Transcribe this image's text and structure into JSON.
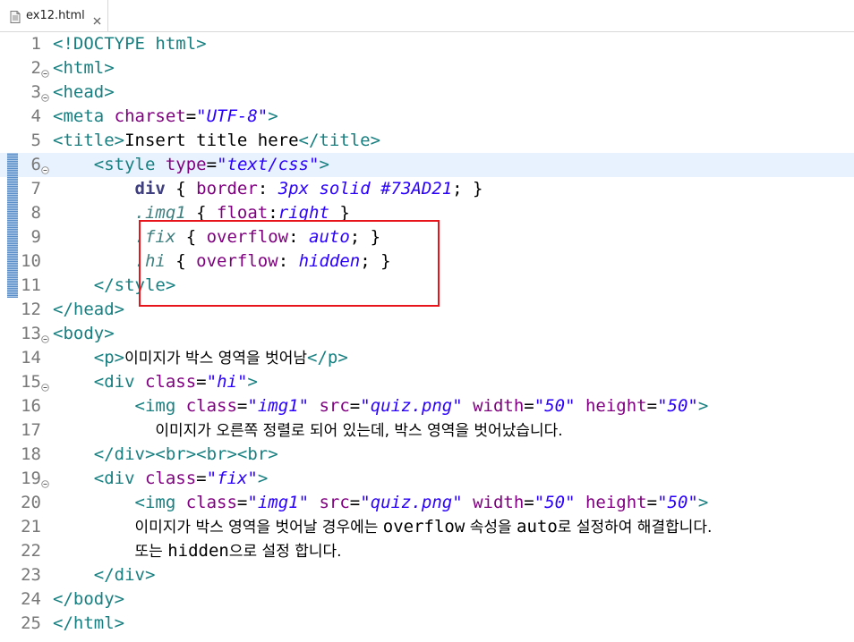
{
  "tab": {
    "filename": "ex12.html",
    "icon": "html-file-icon",
    "close_icon": "close-icon"
  },
  "lines": [
    {
      "num": "1",
      "fold": false,
      "tokens": [
        [
          "tag",
          "<!DOCTYPE html>"
        ]
      ]
    },
    {
      "num": "2",
      "fold": true,
      "tokens": [
        [
          "tag",
          "<html>"
        ]
      ]
    },
    {
      "num": "3",
      "fold": true,
      "tokens": [
        [
          "tag",
          "<head>"
        ]
      ]
    },
    {
      "num": "4",
      "fold": false,
      "tokens": [
        [
          "tag",
          "<meta "
        ],
        [
          "attr",
          "charset"
        ],
        [
          "pun",
          "="
        ],
        [
          "str",
          "\"UTF-8\""
        ],
        [
          "tag",
          ">"
        ]
      ]
    },
    {
      "num": "5",
      "fold": false,
      "tokens": [
        [
          "tag",
          "<title>"
        ],
        [
          "pun",
          "Insert title here"
        ],
        [
          "tag",
          "</title>"
        ]
      ]
    },
    {
      "num": "6",
      "fold": true,
      "tokens": [
        [
          "pun",
          "    "
        ],
        [
          "tag",
          "<style "
        ],
        [
          "attr",
          "type"
        ],
        [
          "pun",
          "="
        ],
        [
          "str",
          "\"text/css\""
        ],
        [
          "tag",
          ">"
        ]
      ]
    },
    {
      "num": "7",
      "fold": false,
      "tokens": [
        [
          "pun",
          "        "
        ],
        [
          "bold",
          "div"
        ],
        [
          "pun",
          " { "
        ],
        [
          "prop",
          "border"
        ],
        [
          "pun",
          ": "
        ],
        [
          "val",
          "3px solid #73AD21"
        ],
        [
          "pun",
          "; }"
        ]
      ]
    },
    {
      "num": "8",
      "fold": false,
      "tokens": [
        [
          "pun",
          "        "
        ],
        [
          "sel",
          ".img1"
        ],
        [
          "pun",
          " { "
        ],
        [
          "prop",
          "float"
        ],
        [
          "pun",
          ":"
        ],
        [
          "val",
          "right"
        ],
        [
          "pun",
          " }"
        ]
      ]
    },
    {
      "num": "9",
      "fold": false,
      "tokens": [
        [
          "pun",
          "        "
        ],
        [
          "sel",
          ".fix"
        ],
        [
          "pun",
          " { "
        ],
        [
          "prop",
          "overflow"
        ],
        [
          "pun",
          ": "
        ],
        [
          "val",
          "auto"
        ],
        [
          "pun",
          "; }"
        ]
      ]
    },
    {
      "num": "10",
      "fold": false,
      "tokens": [
        [
          "pun",
          "        "
        ],
        [
          "sel",
          ".hi"
        ],
        [
          "pun",
          " { "
        ],
        [
          "prop",
          "overflow"
        ],
        [
          "pun",
          ": "
        ],
        [
          "val",
          "hidden"
        ],
        [
          "pun",
          "; }"
        ]
      ]
    },
    {
      "num": "11",
      "fold": false,
      "tokens": [
        [
          "pun",
          "    "
        ],
        [
          "tag",
          "</style>"
        ]
      ]
    },
    {
      "num": "12",
      "fold": false,
      "tokens": [
        [
          "tag",
          "</head>"
        ]
      ]
    },
    {
      "num": "13",
      "fold": true,
      "tokens": [
        [
          "tag",
          "<body>"
        ]
      ]
    },
    {
      "num": "14",
      "fold": false,
      "tokens": [
        [
          "pun",
          "    "
        ],
        [
          "tag",
          "<p>"
        ],
        [
          "kr",
          "이미지가 박스 영역을 벗어남"
        ],
        [
          "tag",
          "</p>"
        ]
      ]
    },
    {
      "num": "15",
      "fold": true,
      "tokens": [
        [
          "pun",
          "    "
        ],
        [
          "tag",
          "<div "
        ],
        [
          "attr",
          "class"
        ],
        [
          "pun",
          "="
        ],
        [
          "str",
          "\"hi\""
        ],
        [
          "tag",
          ">"
        ]
      ]
    },
    {
      "num": "16",
      "fold": false,
      "tokens": [
        [
          "pun",
          "        "
        ],
        [
          "tag",
          "<img "
        ],
        [
          "attr",
          "class"
        ],
        [
          "pun",
          "="
        ],
        [
          "str",
          "\"img1\""
        ],
        [
          "pun",
          " "
        ],
        [
          "attr",
          "src"
        ],
        [
          "pun",
          "="
        ],
        [
          "str",
          "\"quiz.png\""
        ],
        [
          "pun",
          " "
        ],
        [
          "attr",
          "width"
        ],
        [
          "pun",
          "="
        ],
        [
          "str",
          "\"50\""
        ],
        [
          "pun",
          " "
        ],
        [
          "attr",
          "height"
        ],
        [
          "pun",
          "="
        ],
        [
          "str",
          "\"50\""
        ],
        [
          "tag",
          ">"
        ]
      ]
    },
    {
      "num": "17",
      "fold": false,
      "tokens": [
        [
          "pun",
          "          "
        ],
        [
          "kr",
          "이미지가 오른쪽 정렬로 되어 있는데, 박스 영역을 벗어났습니다."
        ]
      ]
    },
    {
      "num": "18",
      "fold": false,
      "tokens": [
        [
          "pun",
          "    "
        ],
        [
          "tag",
          "</div><br><br><br>"
        ]
      ]
    },
    {
      "num": "19",
      "fold": true,
      "tokens": [
        [
          "pun",
          "    "
        ],
        [
          "tag",
          "<div "
        ],
        [
          "attr",
          "class"
        ],
        [
          "pun",
          "="
        ],
        [
          "str",
          "\"fix\""
        ],
        [
          "tag",
          ">"
        ]
      ]
    },
    {
      "num": "20",
      "fold": false,
      "tokens": [
        [
          "pun",
          "        "
        ],
        [
          "tag",
          "<img "
        ],
        [
          "attr",
          "class"
        ],
        [
          "pun",
          "="
        ],
        [
          "str",
          "\"img1\""
        ],
        [
          "pun",
          " "
        ],
        [
          "attr",
          "src"
        ],
        [
          "pun",
          "="
        ],
        [
          "str",
          "\"quiz.png\""
        ],
        [
          "pun",
          " "
        ],
        [
          "attr",
          "width"
        ],
        [
          "pun",
          "="
        ],
        [
          "str",
          "\"50\""
        ],
        [
          "pun",
          " "
        ],
        [
          "attr",
          "height"
        ],
        [
          "pun",
          "="
        ],
        [
          "str",
          "\"50\""
        ],
        [
          "tag",
          ">"
        ]
      ]
    },
    {
      "num": "21",
      "fold": false,
      "tokens": [
        [
          "pun",
          "        "
        ],
        [
          "kr",
          "이미지가 박스 영역을 벗어날 경우에는 "
        ],
        [
          "pun",
          "overflow"
        ],
        [
          "kr",
          " 속성을 "
        ],
        [
          "pun",
          "auto"
        ],
        [
          "kr",
          "로 설정하여 해결합니다."
        ]
      ]
    },
    {
      "num": "22",
      "fold": false,
      "tokens": [
        [
          "pun",
          "        "
        ],
        [
          "kr",
          "또는 "
        ],
        [
          "pun",
          "hidden"
        ],
        [
          "kr",
          "으로 설정 합니다."
        ]
      ]
    },
    {
      "num": "23",
      "fold": false,
      "tokens": [
        [
          "pun",
          "    "
        ],
        [
          "tag",
          "</div>"
        ]
      ]
    },
    {
      "num": "24",
      "fold": false,
      "tokens": [
        [
          "tag",
          "</body>"
        ]
      ]
    },
    {
      "num": "25",
      "fold": false,
      "tokens": [
        [
          "tag",
          "</html>"
        ]
      ]
    }
  ],
  "current_line": "6",
  "changed_lines": [
    "6",
    "11"
  ],
  "highlighted_lines": [
    "9",
    "10"
  ],
  "colors": {
    "tag": "#177f80",
    "attribute": "#7f007f",
    "string": "#2a00ff",
    "highlight_border": "#e8141c",
    "current_line_bg": "#e8f2fe"
  }
}
